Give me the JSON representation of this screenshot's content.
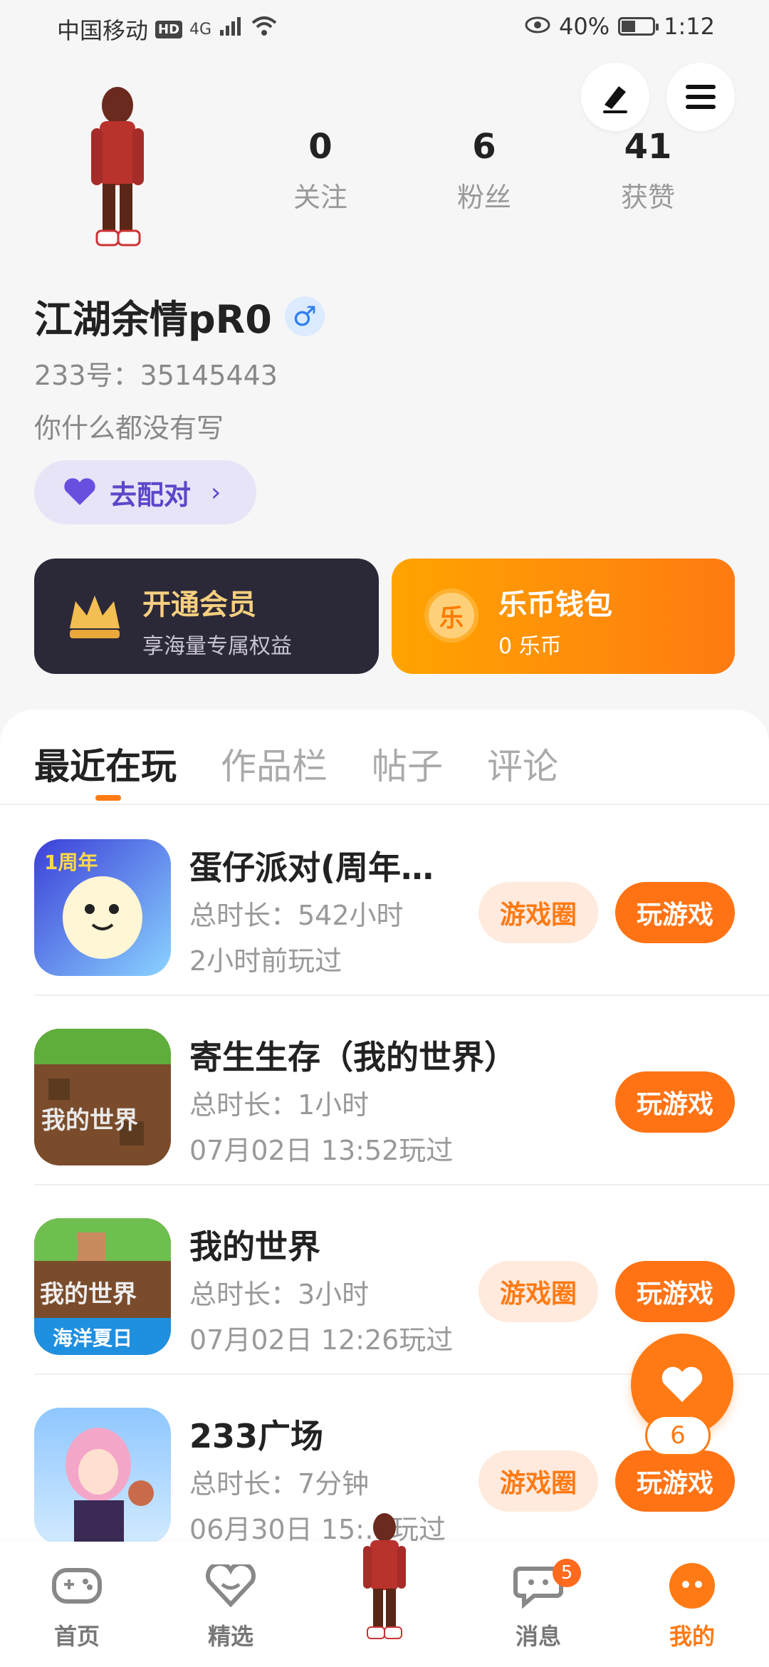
{
  "status_bar": {
    "carrier": "中国移动",
    "hd": "HD",
    "network": "4G",
    "battery": "40%",
    "time": "1:12"
  },
  "profile": {
    "username": "江湖余情pR0",
    "gender_symbol": "♂",
    "id_line": "233号：35145443",
    "bio": "你什么都没有写",
    "match_label": "去配对",
    "stats": [
      {
        "value": "0",
        "label": "关注"
      },
      {
        "value": "6",
        "label": "粉丝"
      },
      {
        "value": "41",
        "label": "获赞"
      }
    ]
  },
  "cards": {
    "vip_title": "开通会员",
    "vip_sub": "享海量专属权益",
    "wallet_title": "乐币钱包",
    "wallet_sub": "0 乐币",
    "wallet_coin": "乐"
  },
  "tabs": [
    "最近在玩",
    "作品栏",
    "帖子",
    "评论"
  ],
  "games": [
    {
      "title": "蛋仔派对(周年…",
      "duration": "总时长：542小时",
      "last": "2小时前玩过",
      "circle": "游戏圈",
      "play": "玩游戏",
      "has_circle": true
    },
    {
      "title": "寄生生存（我的世界）",
      "duration": "总时长：1小时",
      "last": "07月02日 13:52玩过",
      "circle": "",
      "play": "玩游戏",
      "has_circle": false
    },
    {
      "title": "我的世界",
      "duration": "总时长：3小时",
      "last": "07月02日 12:26玩过",
      "circle": "游戏圈",
      "play": "玩游戏",
      "has_circle": true
    },
    {
      "title": "233广场",
      "duration": "总时长：7分钟",
      "last": "06月30日 15:…玩过",
      "circle": "游戏圈",
      "play": "玩游戏",
      "has_circle": true
    }
  ],
  "float_like": {
    "count": "6"
  },
  "nav": {
    "home": "首页",
    "featured": "精选",
    "messages": "消息",
    "messages_badge": "5",
    "mine": "我的"
  },
  "icon_text": {
    "game1": "1周年",
    "game2": "我的世界",
    "game3_top": "我的世界",
    "game3_bottom": "海洋夏日"
  }
}
